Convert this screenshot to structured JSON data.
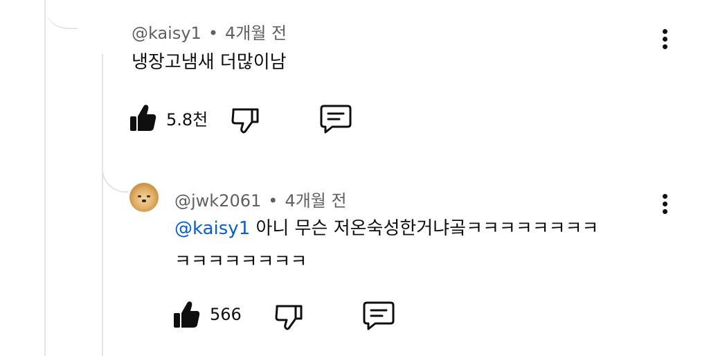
{
  "comments": [
    {
      "author": "@kaisy1",
      "time": "4개월 전",
      "text": "냉장고냄새 더많이남",
      "likes": "5.8천"
    },
    {
      "author": "@jwk2061",
      "time": "4개월 전",
      "mention": "@kaisy1",
      "text_line1": " 아니 무슨 저온숙성한거냐곸ㅋㅋㅋㅋㅋㅋㅋㅋ",
      "text_line2": "ㅋㅋㅋㅋㅋㅋㅋㅋ",
      "likes": "566"
    }
  ],
  "icons": {
    "like": "thumbs-up-icon",
    "dislike": "thumbs-down-icon",
    "reply": "reply-comment-icon",
    "menu": "more-vertical-icon"
  },
  "colors": {
    "mention": "#065fd4",
    "meta": "#606060",
    "text": "#0f0f0f"
  }
}
